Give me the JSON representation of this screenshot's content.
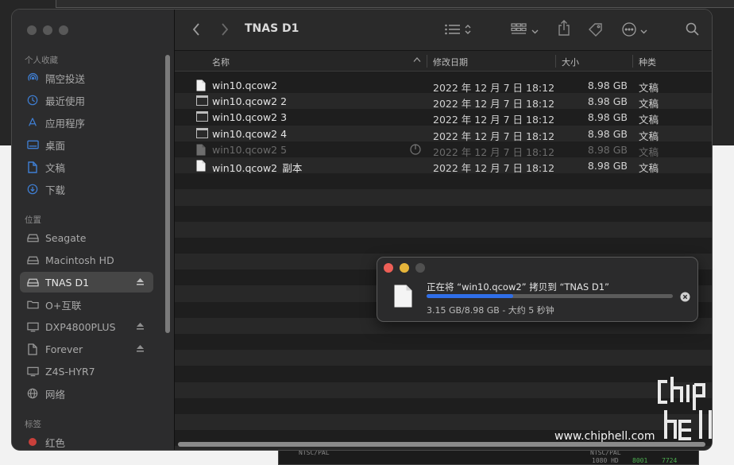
{
  "window": {
    "title": "TNAS D1"
  },
  "sidebar": {
    "favorites_label": "个人收藏",
    "favorites": [
      {
        "label": "隔空投送",
        "icon": "airdrop-icon"
      },
      {
        "label": "最近使用",
        "icon": "clock-icon"
      },
      {
        "label": "应用程序",
        "icon": "applications-icon"
      },
      {
        "label": "桌面",
        "icon": "desktop-icon"
      },
      {
        "label": "文稿",
        "icon": "document-icon"
      },
      {
        "label": "下载",
        "icon": "download-icon"
      }
    ],
    "locations_label": "位置",
    "locations": [
      {
        "label": "Seagate",
        "icon": "drive-icon"
      },
      {
        "label": "Macintosh HD",
        "icon": "drive-icon"
      },
      {
        "label": "TNAS D1",
        "icon": "drive-icon",
        "selected": true,
        "eject": true
      },
      {
        "label": "O+互联",
        "icon": "folder-icon"
      },
      {
        "label": "DXP4800PLUS",
        "icon": "monitor-icon",
        "eject": true
      },
      {
        "label": "Forever",
        "icon": "document-icon",
        "eject": true
      },
      {
        "label": "Z4S-HYR7",
        "icon": "monitor-icon"
      },
      {
        "label": "网络",
        "icon": "globe-icon"
      }
    ],
    "tags_label": "标签",
    "tags": [
      {
        "label": "红色",
        "color": "#e0443e"
      }
    ]
  },
  "columns": {
    "name": "名称",
    "date": "修改日期",
    "size": "大小",
    "kind": "种类"
  },
  "files": [
    {
      "name": "win10.qcow2",
      "date": "2022 年 12 月 7 日 18:12",
      "size": "8.98 GB",
      "kind": "文稿",
      "icon": "blank-document-icon"
    },
    {
      "name": "win10.qcow2 2",
      "date": "2022 年 12 月 7 日 18:12",
      "size": "8.98 GB",
      "kind": "文稿",
      "icon": "terminal-document-icon"
    },
    {
      "name": "win10.qcow2 3",
      "date": "2022 年 12 月 7 日 18:12",
      "size": "8.98 GB",
      "kind": "文稿",
      "icon": "terminal-document-icon"
    },
    {
      "name": "win10.qcow2 4",
      "date": "2022 年 12 月 7 日 18:12",
      "size": "8.98 GB",
      "kind": "文稿",
      "icon": "terminal-document-icon"
    },
    {
      "name": "win10.qcow2 5",
      "date": "2022 年 12 月 7 日 18:12",
      "size": "8.98 GB",
      "kind": "文稿",
      "icon": "blank-document-icon",
      "copying": true
    },
    {
      "name": "win10.qcow2_副本",
      "date": "2022 年 12 月 7 日 18:12",
      "size": "8.98 GB",
      "kind": "文稿",
      "icon": "blank-document-icon"
    }
  ],
  "copy_dialog": {
    "message": "正在将 “win10.qcow2” 拷贝到 “TNAS D1”",
    "progress": 0.35,
    "detail": "3.15 GB/8.98 GB - 大约 5 秒钟",
    "accent": "#2f6ee8"
  },
  "watermark": {
    "url": "www.chiphell.com",
    "logo": "chip hell"
  },
  "background_strip": {
    "left": "NTSC/PAL",
    "right_mode": "NTSC/PAL",
    "resolution": "1080 HD",
    "value_a": "8001",
    "value_b": "7724"
  }
}
